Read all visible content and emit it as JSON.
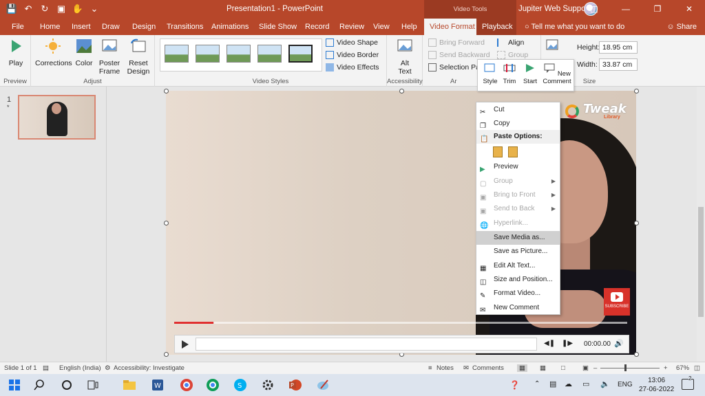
{
  "app": {
    "title": "Presentation1  -  PowerPoint",
    "context_tab_group": "Video Tools",
    "user_name": "Jupiter Web Support"
  },
  "tabs": [
    "File",
    "Home",
    "Insert",
    "Draw",
    "Design",
    "Transitions",
    "Animations",
    "Slide Show",
    "Record",
    "Review",
    "View",
    "Help",
    "Video Format",
    "Playback"
  ],
  "active_tab": "Video Format",
  "tell_me": "Tell me what you want to do",
  "share": "Share",
  "ribbon": {
    "preview": {
      "play": "Play",
      "group": "Preview"
    },
    "adjust": {
      "corrections": "Corrections",
      "color": "Color",
      "poster_frame": [
        "Poster",
        "Frame"
      ],
      "reset_design": [
        "Reset",
        "Design"
      ],
      "group": "Adjust"
    },
    "video_styles": {
      "shape": "Video Shape",
      "border": "Video Border",
      "effects": "Video Effects",
      "group": "Video Styles"
    },
    "accessibility": {
      "alt_text": [
        "Alt",
        "Text"
      ],
      "group": "Accessibility"
    },
    "arrange": {
      "bring_forward": "Bring Forward",
      "send_backward": "Send Backward",
      "selection_pane": "Selection Pane",
      "align": "Align",
      "group_btn": "Group",
      "group": "Ar"
    },
    "size": {
      "height_label": "Height:",
      "height_value": "18.95 cm",
      "width_label": "Width:",
      "width_value": "33.87 cm",
      "group": "Size"
    }
  },
  "mini_toolbar": [
    "Style",
    "Trim",
    "Start",
    "New Comment"
  ],
  "slide_pane": {
    "slide_number": "1",
    "slide_star": "*"
  },
  "video": {
    "watermark": "Tweak",
    "watermark_sub": "Library",
    "subscribe": "SUBSCRIBE",
    "progress_fraction": 0.087
  },
  "mediabar": {
    "time": "00:00.00"
  },
  "context_menu": [
    {
      "label": "Cut",
      "state": "normal",
      "icon": "scissors-icon"
    },
    {
      "label": "Copy",
      "state": "normal",
      "icon": "copy-icon"
    },
    {
      "label": "Paste Options:",
      "state": "header",
      "icon": "clipboard-icon"
    },
    {
      "label": "",
      "state": "paste-row",
      "icon": "paste-icons"
    },
    {
      "label": "Preview",
      "state": "normal",
      "icon": "play-icon"
    },
    {
      "label": "Group",
      "state": "disabled",
      "icon": "group-icon",
      "submenu": true
    },
    {
      "label": "Bring to Front",
      "state": "disabled",
      "icon": "bring-front-icon",
      "submenu": true
    },
    {
      "label": "Send to Back",
      "state": "disabled",
      "icon": "send-back-icon",
      "submenu": true
    },
    {
      "label": "Hyperlink...",
      "state": "disabled",
      "icon": "link-icon"
    },
    {
      "label": "Save Media as...",
      "state": "highlighted",
      "icon": ""
    },
    {
      "label": "Save as Picture...",
      "state": "normal",
      "icon": ""
    },
    {
      "label": "Edit Alt Text...",
      "state": "normal",
      "icon": "alt-text-icon"
    },
    {
      "label": "Size and Position...",
      "state": "normal",
      "icon": "size-icon"
    },
    {
      "label": "Format Video...",
      "state": "normal",
      "icon": "format-icon"
    },
    {
      "label": "New Comment",
      "state": "normal",
      "icon": "comment-icon"
    }
  ],
  "statusbar": {
    "slide": "Slide 1 of 1",
    "language": "English (India)",
    "accessibility": "Accessibility: Investigate",
    "notes": "Notes",
    "comments": "Comments",
    "zoom": "67%"
  },
  "taskbar": {
    "tray_lang": "ENG",
    "time": "13:06",
    "date": "27-06-2022",
    "notif_count": "2"
  },
  "colors": {
    "accent": "#b7472a",
    "highlight": "#d0d0d0"
  }
}
